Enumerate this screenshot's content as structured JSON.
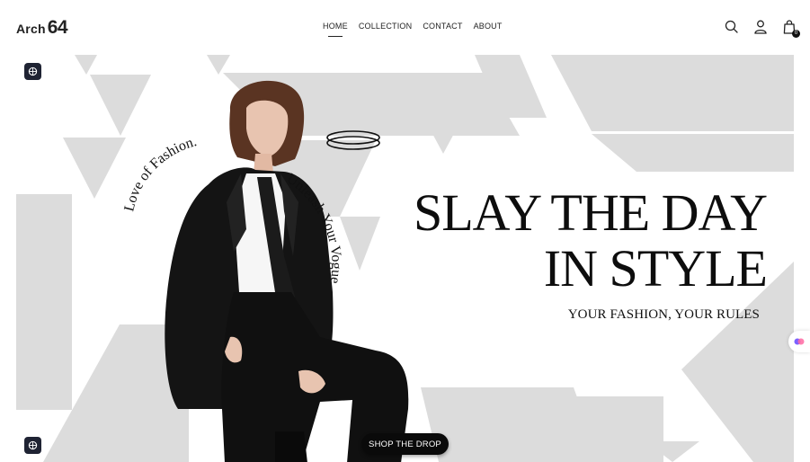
{
  "brand": {
    "name": "Arch",
    "number": "64"
  },
  "nav": {
    "items": [
      {
        "label": "HOME",
        "active": true
      },
      {
        "label": "COLLECTION",
        "active": false
      },
      {
        "label": "CONTACT",
        "active": false
      },
      {
        "label": "ABOUT",
        "active": false
      }
    ]
  },
  "header_icons": {
    "search": "search-icon",
    "account": "user-icon",
    "cart": "shopping-bag-icon",
    "cart_count": "0"
  },
  "hero": {
    "headline_line1": "SLAY THE DAY",
    "headline_line2": "IN STYLE",
    "subheadline": "YOUR FASHION, YOUR RULES",
    "curved_text_left": "Love of Fashion.",
    "curved_text_right": "Unleash Your Vogue",
    "cta_label": "SHOP THE DROP"
  },
  "colors": {
    "pattern": "#dcdcdc",
    "text": "#0d0d0d",
    "button": "#0a0a0a",
    "fab": "#1f2333"
  }
}
